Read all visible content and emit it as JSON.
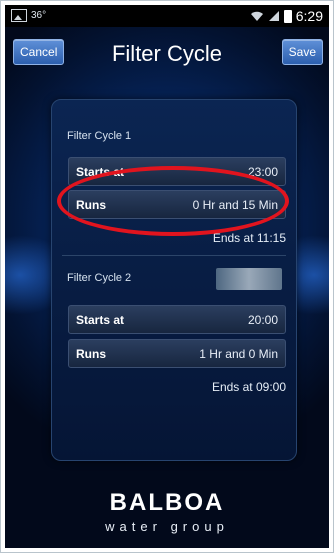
{
  "statusbar": {
    "temp": "36°",
    "time": "6:29"
  },
  "header": {
    "cancel_label": "Cancel",
    "title": "Filter Cycle",
    "save_label": "Save"
  },
  "cycle1": {
    "label": "Filter Cycle 1",
    "starts_label": "Starts at",
    "starts_value": "23:00",
    "runs_label": "Runs",
    "runs_value": "0 Hr and 15 Min",
    "ends": "Ends at 11:15"
  },
  "cycle2": {
    "label": "Filter Cycle 2",
    "starts_label": "Starts at",
    "starts_value": "20:00",
    "runs_label": "Runs",
    "runs_value": "1 Hr and 0 Min",
    "ends": "Ends at 09:00"
  },
  "logo": {
    "main": "BALBOA",
    "sub": "water group"
  },
  "colors": {
    "highlight": "#e1141e",
    "button": "#3e73c2",
    "background": "#06245a"
  },
  "icons": [
    "image-icon",
    "wifi-icon",
    "signal-icon",
    "battery-icon"
  ]
}
